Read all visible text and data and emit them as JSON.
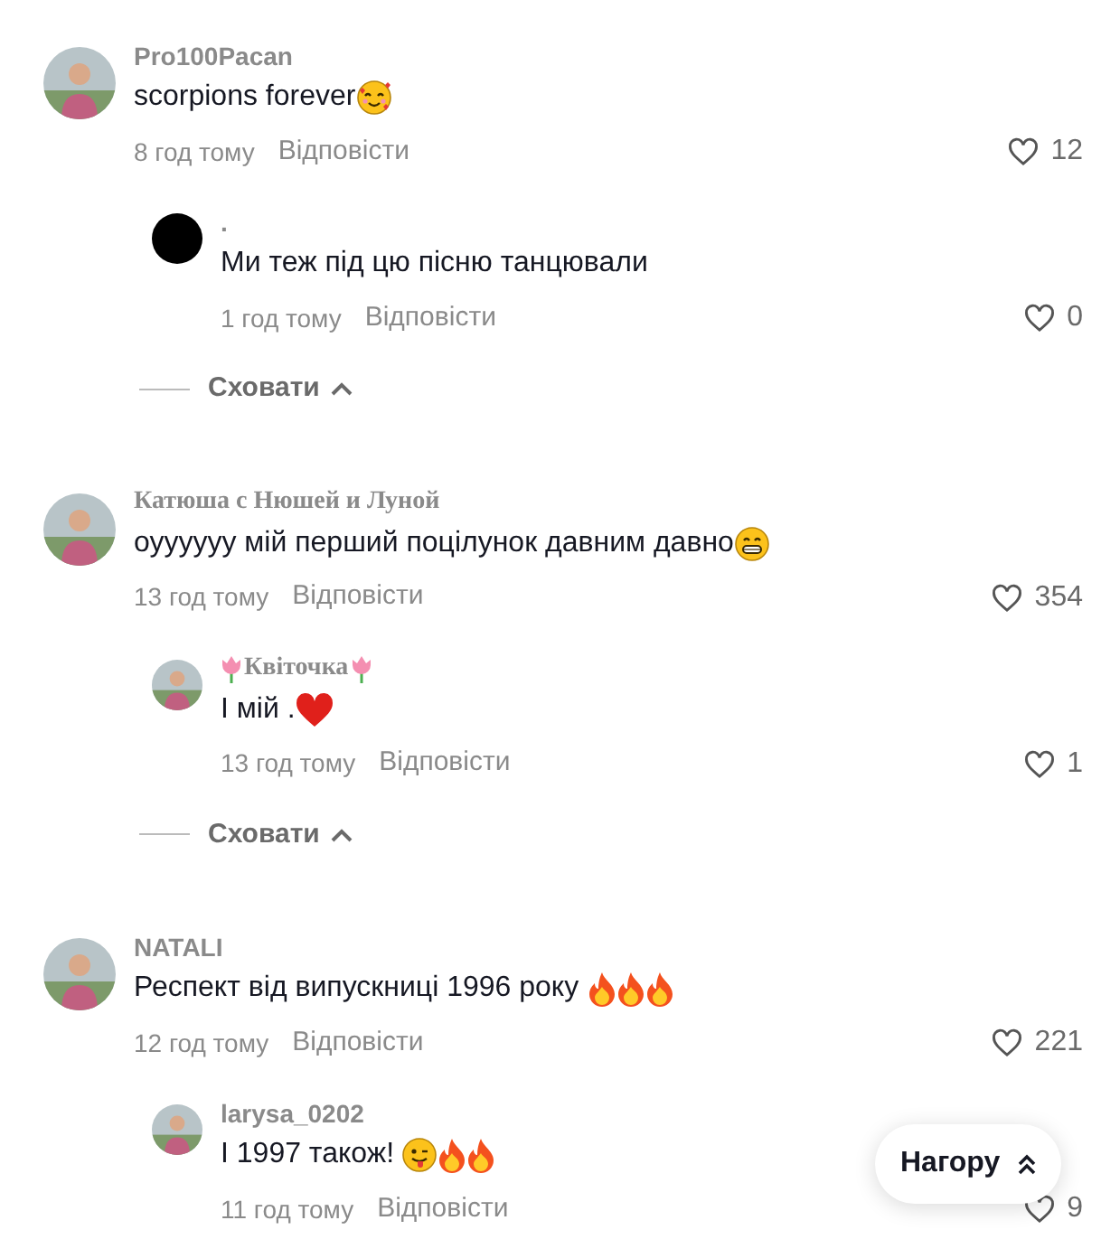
{
  "comments": [
    {
      "username": {
        "text": "Pro100Pacan",
        "kind": "sans"
      },
      "text": "scorpions forever",
      "emojis": [
        {
          "kind": "hearts-face"
        }
      ],
      "time": "8 год тому",
      "reply_label": "Відповісти",
      "likes": "12",
      "replies": [
        {
          "avatar": {
            "kind": "plain"
          },
          "username": {
            "text": ".",
            "kind": "sans"
          },
          "text": "Ми теж під цю пісню танцювали",
          "time": "1 год тому",
          "reply_label": "Відповісти",
          "likes": "0"
        }
      ],
      "collapse_label": "Сховати"
    },
    {
      "username": {
        "text": "Катюша с Нюшей и Луной",
        "kind": "serif"
      },
      "text": "оуууууу мій перший поцілунок давним давно",
      "emojis": [
        {
          "kind": "grin-face"
        }
      ],
      "time": "13 год тому",
      "reply_label": "Відповісти",
      "likes": "354",
      "replies": [
        {
          "username": {
            "text": "Квіточка",
            "kind": "serif",
            "tulips": true
          },
          "text": "І мій .",
          "emojis": [
            {
              "kind": "heart"
            }
          ],
          "time": "13 год тому",
          "reply_label": "Відповісти",
          "likes": "1"
        }
      ],
      "collapse_label": "Сховати"
    },
    {
      "username": {
        "text": "NATALI",
        "kind": "sans"
      },
      "text": "Респект від випускниці 1996 року ",
      "emojis": [
        {
          "kind": "fire"
        },
        {
          "kind": "fire"
        },
        {
          "kind": "fire"
        }
      ],
      "time": "12 год тому",
      "reply_label": "Відповісти",
      "likes": "221",
      "replies": [
        {
          "username": {
            "text": "larysa_0202",
            "kind": "sans"
          },
          "text": "І 1997 також! ",
          "emojis": [
            {
              "kind": "wink-tongue-face"
            },
            {
              "kind": "fire"
            },
            {
              "kind": "fire"
            }
          ],
          "time": "11 год тому",
          "reply_label": "Відповісти",
          "likes": "9"
        }
      ]
    }
  ],
  "top_button": {
    "label": "Нагору"
  }
}
